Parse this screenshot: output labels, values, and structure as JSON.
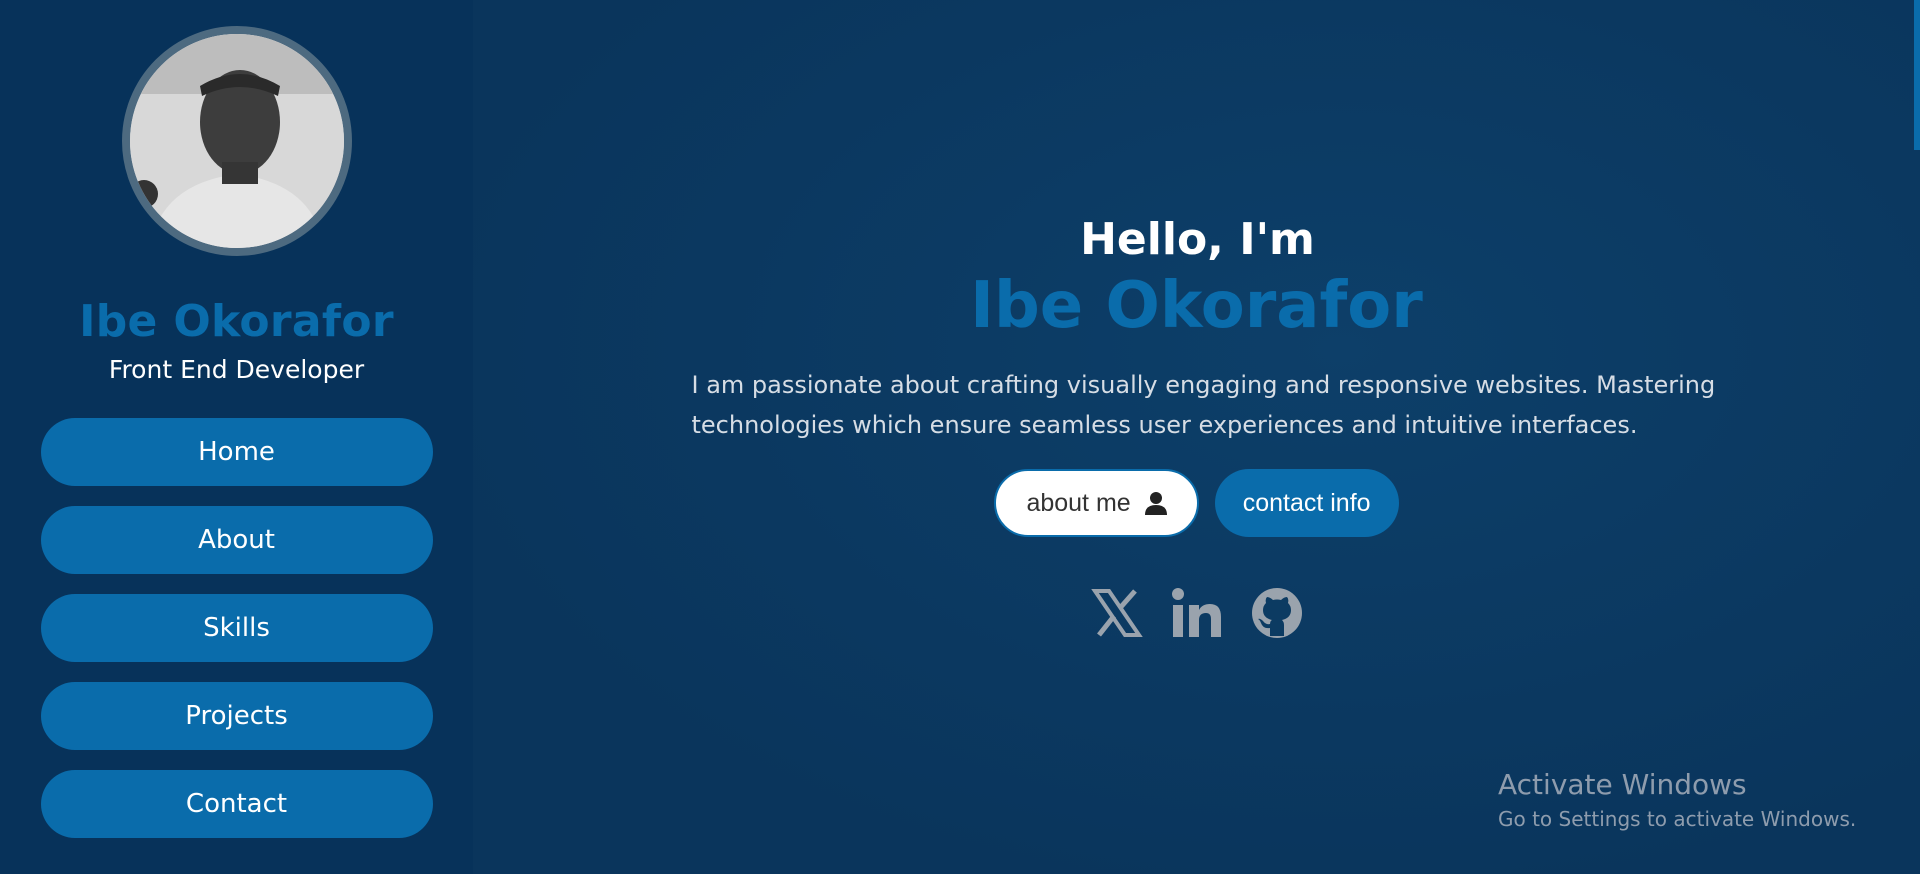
{
  "sidebar": {
    "name": "Ibe Okorafor",
    "role": "Front End Developer",
    "nav": [
      {
        "label": "Home"
      },
      {
        "label": "About"
      },
      {
        "label": "Skills"
      },
      {
        "label": "Projects"
      },
      {
        "label": "Contact"
      }
    ]
  },
  "hero": {
    "greeting": "Hello, I'm",
    "name": "Ibe Okorafor",
    "bio": "I am passionate about crafting visually engaging and responsive websites. Mastering technologies which ensure seamless user experiences and intuitive interfaces.",
    "about_button": "about me",
    "contact_button": "contact info",
    "socials": [
      "x-icon",
      "linkedin-icon",
      "github-icon"
    ]
  },
  "watermark": {
    "title": "Activate Windows",
    "subtitle": "Go to Settings to activate Windows."
  },
  "colors": {
    "accent": "#0a6cab",
    "sidebar_bg": "#07325a",
    "main_bg": "#0c3b62"
  }
}
